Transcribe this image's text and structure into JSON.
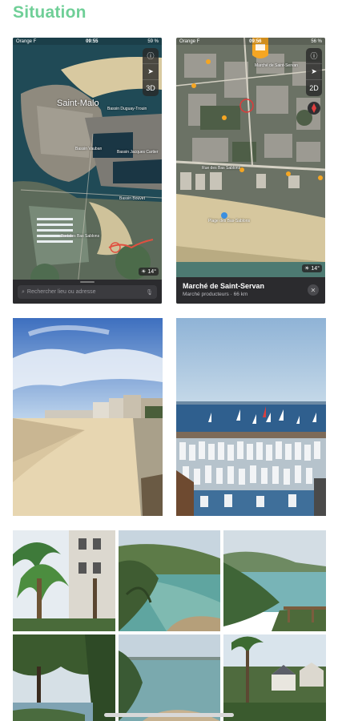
{
  "page": {
    "title": "Situation"
  },
  "map1": {
    "status": {
      "carrier": "Orange F",
      "time": "09:55",
      "battery": "59 %"
    },
    "controls": [
      "ⓘ",
      "➤",
      "3D"
    ],
    "city_label": "Saint-Malo",
    "places": [
      "Bassin Vauban",
      "Bassin Jacques Cartier",
      "Bassin Duguay-Trouin",
      "Bassin Bouvet",
      "Port des Bas Sablons"
    ],
    "weather": "14°",
    "search_placeholder": "Rechercher lieu ou adresse",
    "icons": [
      "magnifier-icon",
      "microphone-icon"
    ]
  },
  "map2": {
    "status": {
      "carrier": "Orange F",
      "time": "09:56",
      "battery": "56 %"
    },
    "controls": [
      "ⓘ",
      "➤",
      "2D"
    ],
    "pin_label": "Marché de Saint-Servan",
    "streets": [
      "Rue des Bas Sablons",
      "Plage des Bas-Sablons"
    ],
    "weather": "14°",
    "panel": {
      "name": "Marché de Saint-Servan",
      "subtitle": "Marché producteurs · 66 km"
    },
    "colors": {
      "pin": "#f5a623"
    }
  },
  "photos": {
    "beach_alt": "Plage des Bas-Sablons",
    "marina_alt": "Port des Bas-Sablons",
    "grid_alt": [
      "Palmiers",
      "Crique verte",
      "Vue mer",
      "Arbres sur la baie",
      "Baie",
      "Maisons et palmiers"
    ]
  },
  "colors": {
    "title": "#6fcf97",
    "panel": "#2b2b2e"
  }
}
